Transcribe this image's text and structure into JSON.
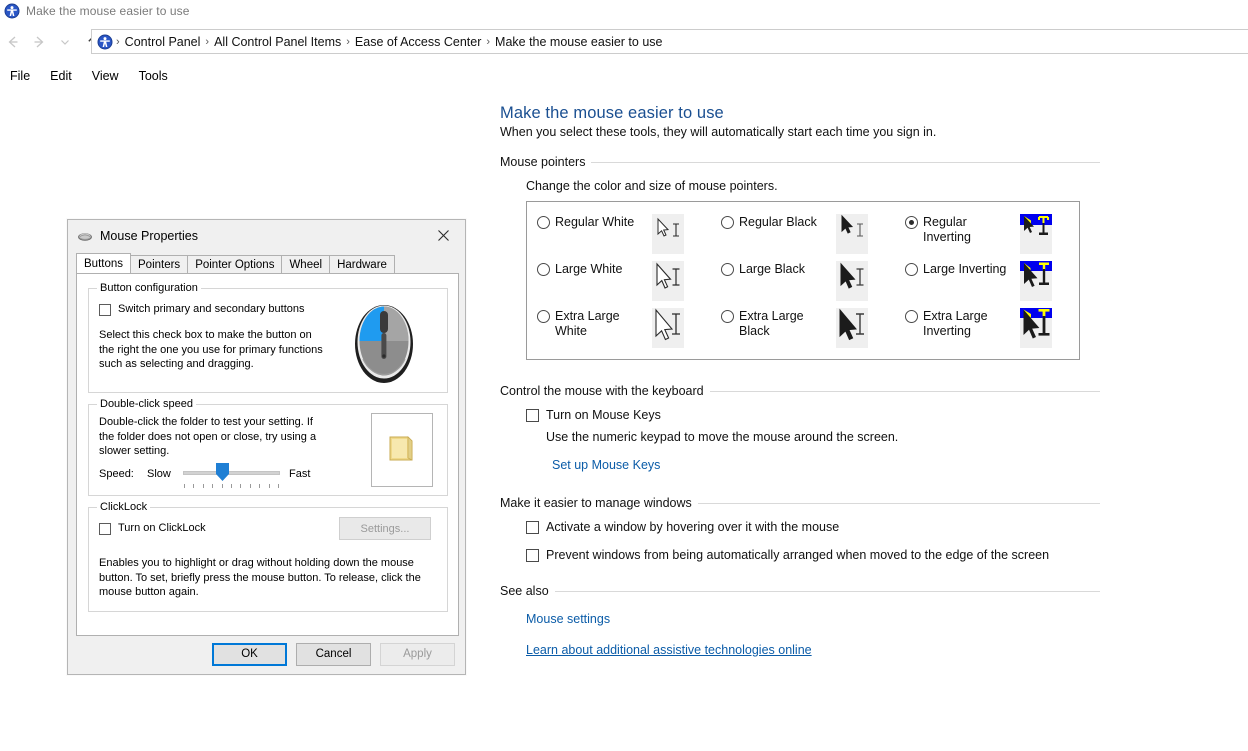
{
  "window": {
    "title": "Make the mouse easier to use",
    "title_icon": "ease-of-access-icon"
  },
  "nav": {
    "back_icon": "back-arrow-icon",
    "forward_icon": "forward-arrow-icon",
    "history_icon": "chevron-down-icon",
    "up_icon": "up-arrow-icon",
    "address_icon": "ease-of-access-icon",
    "breadcrumbs": [
      "Control Panel",
      "All Control Panel Items",
      "Ease of Access Center",
      "Make the mouse easier to use"
    ],
    "separator": "›"
  },
  "menu": {
    "items": [
      "File",
      "Edit",
      "View",
      "Tools"
    ]
  },
  "main": {
    "title": "Make the mouse easier to use",
    "subtitle": "When you select these tools, they will automatically start each time you sign in.",
    "pointers": {
      "section_label": "Mouse pointers",
      "hint": "Change the color and size of mouse pointers.",
      "options": [
        {
          "label": "Regular White",
          "selected": false,
          "style": "white",
          "size": "regular"
        },
        {
          "label": "Regular Black",
          "selected": false,
          "style": "black",
          "size": "regular"
        },
        {
          "label": "Regular Inverting",
          "selected": true,
          "style": "inverting",
          "size": "regular"
        },
        {
          "label": "Large White",
          "selected": false,
          "style": "white",
          "size": "large"
        },
        {
          "label": "Large Black",
          "selected": false,
          "style": "black",
          "size": "large"
        },
        {
          "label": "Large Inverting",
          "selected": false,
          "style": "inverting",
          "size": "large"
        },
        {
          "label": "Extra Large White",
          "selected": false,
          "style": "white",
          "size": "xlarge"
        },
        {
          "label": "Extra Large Black",
          "selected": false,
          "style": "black",
          "size": "xlarge"
        },
        {
          "label": "Extra Large Inverting",
          "selected": false,
          "style": "inverting",
          "size": "xlarge"
        }
      ]
    },
    "keyboard": {
      "section_label": "Control the mouse with the keyboard",
      "mouse_keys_label": "Turn on Mouse Keys",
      "mouse_keys_checked": false,
      "description": "Use the numeric keypad to move the mouse around the screen.",
      "setup_link": "Set up Mouse Keys"
    },
    "windows": {
      "section_label": "Make it easier to manage windows",
      "activate_label": "Activate a window by hovering over it with the mouse",
      "activate_checked": false,
      "prevent_label": "Prevent windows from being automatically arranged when moved to the edge of the screen",
      "prevent_checked": false
    },
    "see_also": {
      "section_label": "See also",
      "links": [
        {
          "text": "Mouse settings",
          "underline": false
        },
        {
          "text": "Learn about additional assistive technologies online",
          "underline": true
        }
      ]
    }
  },
  "dialog": {
    "title": "Mouse Properties",
    "title_icon": "mouse-icon",
    "close_icon": "close-icon",
    "tabs": [
      {
        "label": "Buttons",
        "active": true
      },
      {
        "label": "Pointers",
        "active": false
      },
      {
        "label": "Pointer Options",
        "active": false
      },
      {
        "label": "Wheel",
        "active": false
      },
      {
        "label": "Hardware",
        "active": false
      }
    ],
    "button_config": {
      "group_title": "Button configuration",
      "switch_label": "Switch primary and secondary buttons",
      "switch_checked": false,
      "description": "Select this check box to make the button on the right the one you use for primary functions such as selecting and dragging.",
      "image": "mouse-graphic"
    },
    "double_click": {
      "group_title": "Double-click speed",
      "description": "Double-click the folder to test your setting. If the folder does not open or close, try using a slower setting.",
      "speed_label": "Speed:",
      "slow_label": "Slow",
      "fast_label": "Fast",
      "slider_value": 50,
      "test_icon": "folder-icon"
    },
    "clicklock": {
      "group_title": "ClickLock",
      "toggle_label": "Turn on ClickLock",
      "toggle_checked": false,
      "settings_button": "Settings...",
      "settings_enabled": false,
      "description": "Enables you to highlight or drag without holding down the mouse button. To set, briefly press the mouse button. To release, click the mouse button again."
    },
    "footer": {
      "ok": "OK",
      "cancel": "Cancel",
      "apply": "Apply",
      "apply_enabled": false
    }
  },
  "colors": {
    "accent": "#0078d7",
    "link": "#0b5ca8",
    "heading": "#1a4f91",
    "dialog_bg": "#f0f0f0",
    "inverting_blue": "#0000ee",
    "inverting_yellow": "#ffff00"
  }
}
